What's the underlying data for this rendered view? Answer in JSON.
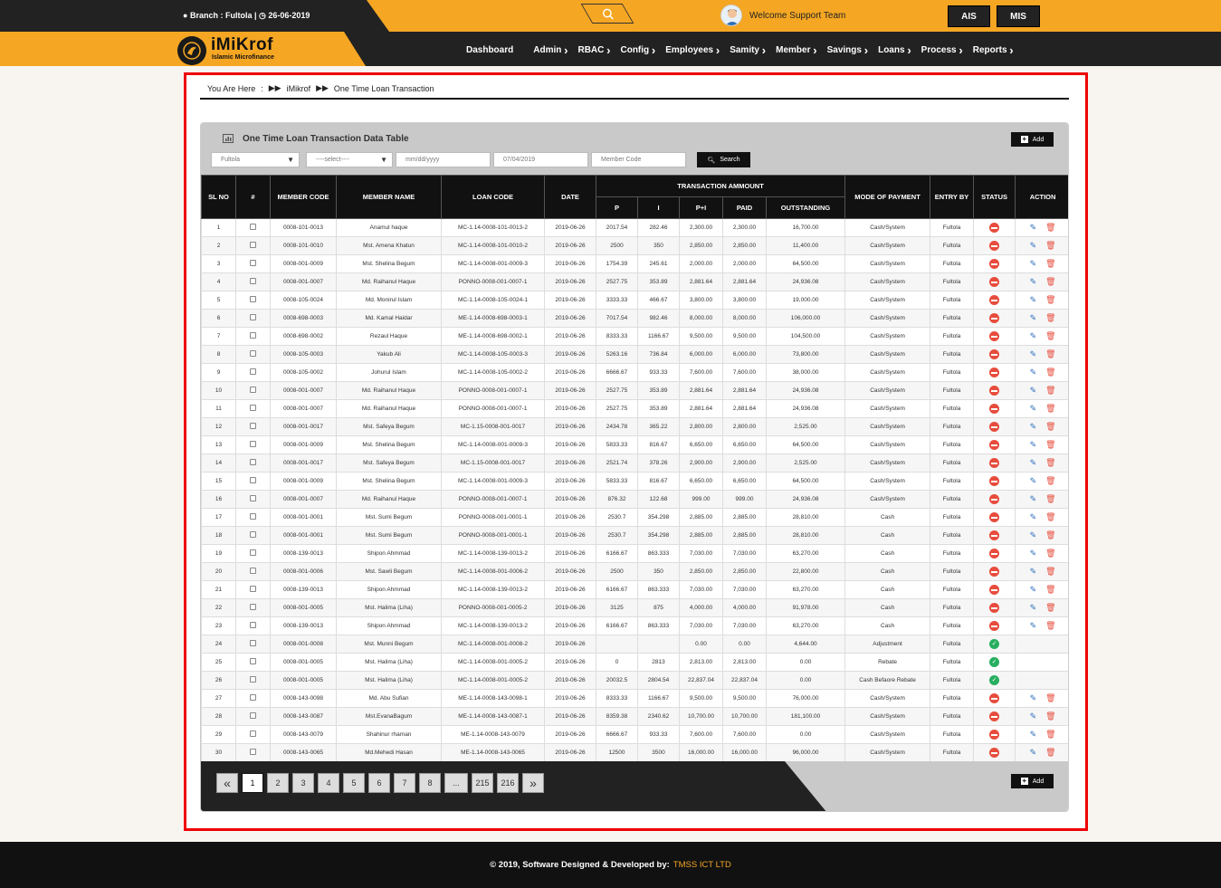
{
  "header": {
    "branch": "Branch : Fultola",
    "date": "26-06-2019",
    "welcome": "Welcome Support Team",
    "btn_ais": "AIS",
    "btn_mis": "MIS"
  },
  "logo": {
    "title": "iMiKrof",
    "subtitle": "Islamic Microfinance"
  },
  "nav": [
    {
      "label": "Dashboard",
      "arrow": ""
    },
    {
      "label": "Admin",
      "arrow": "›"
    },
    {
      "label": "RBAC",
      "arrow": "›"
    },
    {
      "label": "Config",
      "arrow": "›"
    },
    {
      "label": "Employees",
      "arrow": "›"
    },
    {
      "label": "Samity",
      "arrow": "›"
    },
    {
      "label": "Member",
      "arrow": "›"
    },
    {
      "label": "Savings",
      "arrow": "›"
    },
    {
      "label": "Loans",
      "arrow": "›"
    },
    {
      "label": "Process",
      "arrow": "›"
    },
    {
      "label": "Reports",
      "arrow": "›"
    }
  ],
  "breadcrumb": {
    "prefix": "You Are Here",
    "sep1": ":",
    "home": "iMikrof",
    "current": "One Time Loan Transaction"
  },
  "panel": {
    "title": "One Time Loan Transaction Data Table",
    "add_label": "Add",
    "filters": {
      "branch": "Fultola",
      "select": "----select----",
      "date_from_placeholder": "mm/dd/yyyy",
      "date_to": "07/04/2019",
      "member_placeholder": "Member Code"
    },
    "search_label": "Search"
  },
  "table": {
    "headers": {
      "sl": "SL NO",
      "hash": "#",
      "member_code": "MEMBER CODE",
      "member_name": "MEMBER NAME",
      "loan_code": "LOAN CODE",
      "date": "DATE",
      "txn": "TRANSACTION AMMOUNT",
      "p": "P",
      "i": "I",
      "pi": "P+I",
      "paid": "PAID",
      "outstanding": "OUTSTANDING",
      "mode": "MODE OF PAYMENT",
      "entry": "ENTRY BY",
      "status": "STATUS",
      "action": "ACTION"
    },
    "rows": [
      [
        "1",
        "0008-101-0013",
        "Anamul haque",
        "MC-1.14-0008-101-0013-2",
        "2019-06-26",
        "2017.54",
        "282.46",
        "2,300.00",
        "2,300.00",
        "16,700.00",
        "Cash/System",
        "Fultola",
        "red"
      ],
      [
        "2",
        "0008-101-0010",
        "Mst. Amena Khatun",
        "MC-1.14-0008-101-0010-2",
        "2019-06-26",
        "2500",
        "350",
        "2,850.00",
        "2,850.00",
        "11,400.00",
        "Cash/System",
        "Fultola",
        "red"
      ],
      [
        "3",
        "0008-001-0009",
        "Mst. Shelina Begum",
        "MC-1.14-0008-001-0009-3",
        "2019-06-26",
        "1754.39",
        "245.61",
        "2,000.00",
        "2,000.00",
        "64,500.00",
        "Cash/System",
        "Fultola",
        "red"
      ],
      [
        "4",
        "0008-001-0007",
        "Md. Raihanul Haque",
        "PONNO-0008-001-0007-1",
        "2019-06-26",
        "2527.75",
        "353.89",
        "2,881.64",
        "2,881.64",
        "24,936.08",
        "Cash/System",
        "Fultola",
        "red"
      ],
      [
        "5",
        "0008-105-0024",
        "Md. Monirul Islam",
        "MC-1.14-0008-105-0024-1",
        "2019-06-26",
        "3333.33",
        "466.67",
        "3,800.00",
        "3,800.00",
        "19,000.00",
        "Cash/System",
        "Fultola",
        "red"
      ],
      [
        "6",
        "0008-698-0003",
        "Md. Kamal Haidar",
        "ME-1.14-0008-698-0003-1",
        "2019-06-26",
        "7017.54",
        "982.46",
        "8,000.00",
        "8,000.00",
        "106,000.00",
        "Cash/System",
        "Fultola",
        "red"
      ],
      [
        "7",
        "0008-698-0002",
        "Rezaul Haque",
        "ME-1.14-0008-698-0002-1",
        "2019-06-26",
        "8333.33",
        "1166.67",
        "9,500.00",
        "9,500.00",
        "104,500.00",
        "Cash/System",
        "Fultola",
        "red"
      ],
      [
        "8",
        "0008-105-0003",
        "Yakub Ali",
        "MC-1.14-0008-105-0003-3",
        "2019-06-26",
        "5263.16",
        "736.84",
        "6,000.00",
        "6,000.00",
        "73,800.00",
        "Cash/System",
        "Fultola",
        "red"
      ],
      [
        "9",
        "0008-105-0002",
        "Johurul Islam",
        "MC-1.14-0008-105-0002-2",
        "2019-06-26",
        "6666.67",
        "933.33",
        "7,600.00",
        "7,600.00",
        "38,000.00",
        "Cash/System",
        "Fultola",
        "red"
      ],
      [
        "10",
        "0008-001-0007",
        "Md. Raihanul Haque",
        "PONNO-0008-001-0007-1",
        "2019-06-26",
        "2527.75",
        "353.89",
        "2,881.64",
        "2,881.64",
        "24,936.08",
        "Cash/System",
        "Fultola",
        "red"
      ],
      [
        "11",
        "0008-001-0007",
        "Md. Raihanul Haque",
        "PONNO-0008-001-0007-1",
        "2019-06-26",
        "2527.75",
        "353.89",
        "2,881.64",
        "2,881.64",
        "24,936.08",
        "Cash/System",
        "Fultola",
        "red"
      ],
      [
        "12",
        "0008-001-0017",
        "Mst. Safeya Begum",
        "MC-1.15-0008-001-0017",
        "2019-06-26",
        "2434.78",
        "365.22",
        "2,800.00",
        "2,800.00",
        "2,525.00",
        "Cash/System",
        "Fultola",
        "red"
      ],
      [
        "13",
        "0008-001-0009",
        "Mst. Shelina Begum",
        "MC-1.14-0008-001-0009-3",
        "2019-06-26",
        "5833.33",
        "816.67",
        "6,650.00",
        "6,650.00",
        "64,500.00",
        "Cash/System",
        "Fultola",
        "red"
      ],
      [
        "14",
        "0008-001-0017",
        "Mst. Safeya Begum",
        "MC-1.15-0008-001-0017",
        "2019-06-26",
        "2521.74",
        "378.26",
        "2,900.00",
        "2,900.00",
        "2,525.00",
        "Cash/System",
        "Fultola",
        "red"
      ],
      [
        "15",
        "0008-001-0009",
        "Mst. Shelina Begum",
        "MC-1.14-0008-001-0009-3",
        "2019-06-26",
        "5833.33",
        "816.67",
        "6,650.00",
        "6,650.00",
        "64,500.00",
        "Cash/System",
        "Fultola",
        "red"
      ],
      [
        "16",
        "0008-001-0007",
        "Md. Raihanul Haque",
        "PONNO-0008-001-0007-1",
        "2019-06-26",
        "876.32",
        "122.68",
        "999.00",
        "999.00",
        "24,936.08",
        "Cash/System",
        "Fultola",
        "red"
      ],
      [
        "17",
        "0008-001-0001",
        "Mst. Sumi Begum",
        "PONNO-0008-001-0001-1",
        "2019-06-26",
        "2530.7",
        "354.298",
        "2,885.00",
        "2,885.00",
        "28,810.00",
        "Cash",
        "Fultola",
        "red"
      ],
      [
        "18",
        "0008-001-0001",
        "Mst. Sumi Begum",
        "PONNO-0008-001-0001-1",
        "2019-06-26",
        "2530.7",
        "354.298",
        "2,885.00",
        "2,885.00",
        "28,810.00",
        "Cash",
        "Fultola",
        "red"
      ],
      [
        "19",
        "0008-139-0013",
        "Shipon Ahmmad",
        "MC-1.14-0008-139-0013-2",
        "2019-06-26",
        "6166.67",
        "863.333",
        "7,030.00",
        "7,030.00",
        "63,270.00",
        "Cash",
        "Fultola",
        "red"
      ],
      [
        "20",
        "0008-001-0006",
        "Mst. Sawli Begum",
        "MC-1.14-0008-001-0006-2",
        "2019-06-26",
        "2500",
        "350",
        "2,850.00",
        "2,850.00",
        "22,800.00",
        "Cash",
        "Fultola",
        "red"
      ],
      [
        "21",
        "0008-139-0013",
        "Shipon Ahmmad",
        "MC-1.14-0008-139-0013-2",
        "2019-06-26",
        "6166.67",
        "863.333",
        "7,030.00",
        "7,030.00",
        "63,270.00",
        "Cash",
        "Fultola",
        "red"
      ],
      [
        "22",
        "0008-001-0005",
        "Mst. Halima (Liha)",
        "PONNO-0008-001-0005-2",
        "2019-06-26",
        "3125",
        "875",
        "4,000.00",
        "4,000.00",
        "91,978.00",
        "Cash",
        "Fultola",
        "red"
      ],
      [
        "23",
        "0008-139-0013",
        "Shipon Ahmmad",
        "MC-1.14-0008-139-0013-2",
        "2019-06-26",
        "6166.67",
        "863.333",
        "7,030.00",
        "7,030.00",
        "63,270.00",
        "Cash",
        "Fultola",
        "red"
      ],
      [
        "24",
        "0008-001-0008",
        "Mst. Munni Begum",
        "MC-1.14-0008-001-0008-2",
        "2019-06-26",
        "",
        "",
        "0.00",
        "0.00",
        "4,644.00",
        "Adjustment",
        "Fultola",
        "green"
      ],
      [
        "25",
        "0008-001-0005",
        "Mst. Halima (Liha)",
        "MC-1.14-0008-001-0005-2",
        "2019-06-26",
        "0",
        "2813",
        "2,813.00",
        "2,813.00",
        "0.00",
        "Rebate",
        "Fultola",
        "green"
      ],
      [
        "26",
        "0008-001-0005",
        "Mst. Halima (Liha)",
        "MC-1.14-0008-001-0005-2",
        "2019-06-26",
        "20032.5",
        "2804.54",
        "22,837.04",
        "22,837.04",
        "0.00",
        "Cash Befaore Rebate",
        "Fultola",
        "green"
      ],
      [
        "27",
        "0008-143-0098",
        "Md. Abu Sufian",
        "ME-1.14-0008-143-0098-1",
        "2019-06-26",
        "8333.33",
        "1166.67",
        "9,500.00",
        "9,500.00",
        "76,000.00",
        "Cash/System",
        "Fultola",
        "red"
      ],
      [
        "28",
        "0008-143-0087",
        "Mst.EvanaBagum",
        "ME-1.14-0008-143-0087-1",
        "2019-06-26",
        "8359.38",
        "2340.62",
        "10,700.00",
        "10,700.00",
        "181,100.00",
        "Cash/System",
        "Fultola",
        "red"
      ],
      [
        "29",
        "0008-143-0079",
        "Shahinur rhaman",
        "ME-1.14-0008-143-0079",
        "2019-06-26",
        "6666.67",
        "933.33",
        "7,600.00",
        "7,600.00",
        "0.00",
        "Cash/System",
        "Fultola",
        "red"
      ],
      [
        "30",
        "0008-143-0065",
        "Md.Mehedi Hasan",
        "ME-1.14-0008-143-0065",
        "2019-06-26",
        "12500",
        "3500",
        "16,000.00",
        "16,000.00",
        "96,000.00",
        "Cash/System",
        "Fultola",
        "red"
      ]
    ]
  },
  "pagination": [
    "«",
    "1",
    "2",
    "3",
    "4",
    "5",
    "6",
    "7",
    "8",
    "...",
    "215",
    "216",
    "»"
  ],
  "pagination_active": "1",
  "footer": {
    "text": "© 2019, Software Designed & Developed by:",
    "developer": "TMSS ICT LTD"
  },
  "colors": {
    "accent": "#f5a623",
    "dark": "#222222",
    "status_red": "#e74c3c",
    "status_green": "#27ae60",
    "frame": "#ee0000"
  }
}
